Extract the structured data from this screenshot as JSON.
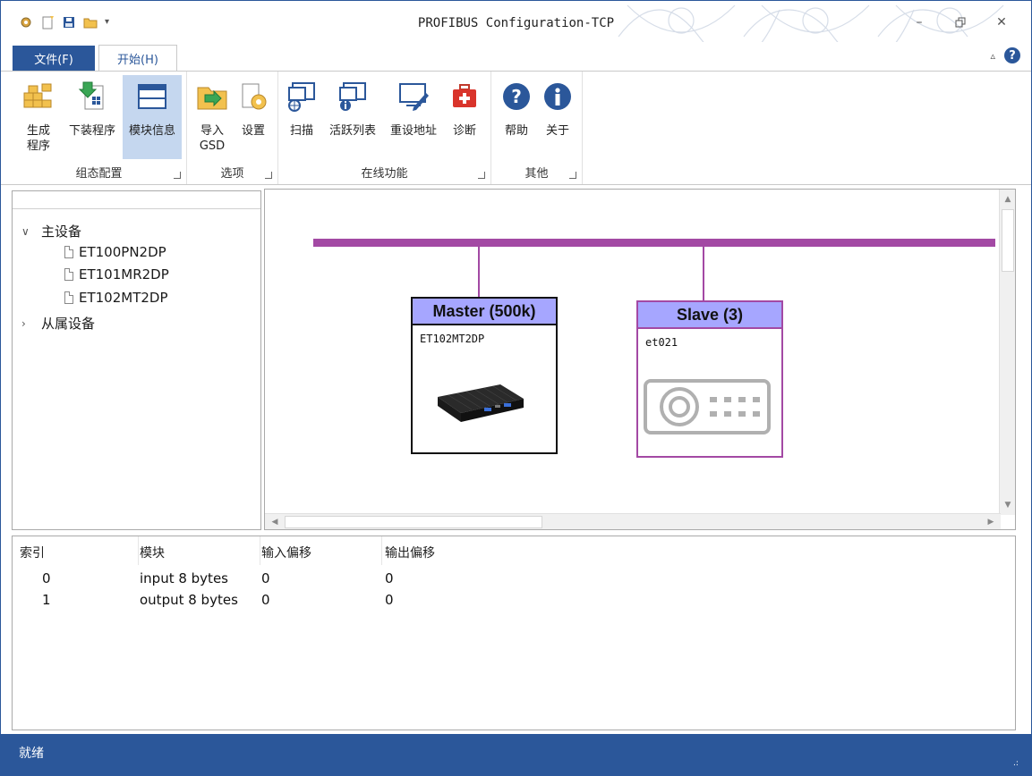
{
  "window": {
    "title": "PROFIBUS Configuration-TCP"
  },
  "tabs": {
    "file": "文件(F)",
    "home": "开始(H)"
  },
  "ribbon": {
    "groups": [
      {
        "label": "组态配置",
        "buttons": [
          "生成\n程序",
          "下装程序",
          "模块信息"
        ]
      },
      {
        "label": "选项",
        "buttons": [
          "导入\nGSD",
          "设置"
        ]
      },
      {
        "label": "在线功能",
        "buttons": [
          "扫描",
          "活跃列表",
          "重设地址",
          "诊断"
        ]
      },
      {
        "label": "其他",
        "buttons": [
          "帮助",
          "关于"
        ]
      }
    ],
    "selected_button": "模块信息"
  },
  "tree": {
    "master_group": "主设备",
    "master_items": [
      "ET100PN2DP",
      "ET101MR2DP",
      "ET102MT2DP"
    ],
    "slave_group": "从属设备"
  },
  "diagram": {
    "bus_color": "#a349a4",
    "master": {
      "title": "Master (500k)",
      "model": "ET102MT2DP"
    },
    "slave": {
      "title": "Slave (3)",
      "model": "et021"
    }
  },
  "table": {
    "headers": [
      "索引",
      "模块",
      "输入偏移",
      "输出偏移"
    ],
    "rows": [
      [
        "0",
        "input 8 bytes",
        "0",
        "0"
      ],
      [
        "1",
        "output 8 bytes",
        "0",
        "0"
      ]
    ]
  },
  "status": {
    "text": "就绪"
  },
  "colors": {
    "accent": "#2b579a",
    "device_header": "#a6a6ff"
  }
}
